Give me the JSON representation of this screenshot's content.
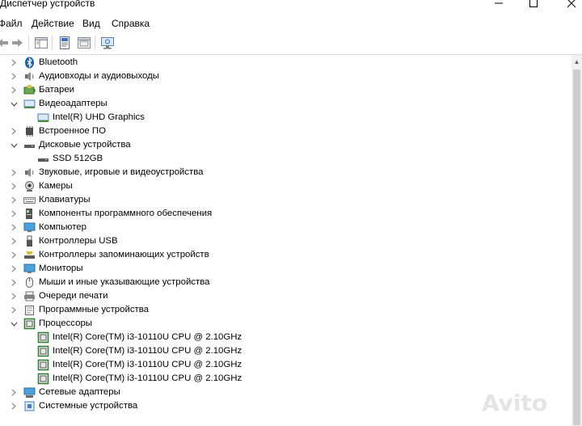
{
  "window": {
    "title": "Диспетчер устройств"
  },
  "menu": [
    "Файл",
    "Действие",
    "Вид",
    "Справка"
  ],
  "tree": [
    {
      "label": "Bluetooth",
      "icon": "bluetooth-icon",
      "level": 0,
      "state": "collapsed"
    },
    {
      "label": "Аудиовходы и аудиовыходы",
      "icon": "speaker-icon",
      "level": 0,
      "state": "collapsed"
    },
    {
      "label": "Батареи",
      "icon": "battery-icon",
      "level": 0,
      "state": "collapsed"
    },
    {
      "label": "Видеоадаптеры",
      "icon": "display-adapter-icon",
      "level": 0,
      "state": "expanded"
    },
    {
      "label": "Intel(R) UHD Graphics",
      "icon": "display-adapter-icon",
      "level": 1,
      "state": "leaf"
    },
    {
      "label": "Встроенное ПО",
      "icon": "firmware-icon",
      "level": 0,
      "state": "collapsed"
    },
    {
      "label": "Дисковые устройства",
      "icon": "disk-drive-icon",
      "level": 0,
      "state": "expanded"
    },
    {
      "label": "SSD 512GB",
      "icon": "disk-drive-icon",
      "level": 1,
      "state": "leaf"
    },
    {
      "label": "Звуковые, игровые и видеоустройства",
      "icon": "speaker-icon",
      "level": 0,
      "state": "collapsed"
    },
    {
      "label": "Камеры",
      "icon": "camera-icon",
      "level": 0,
      "state": "collapsed"
    },
    {
      "label": "Клавиатуры",
      "icon": "keyboard-icon",
      "level": 0,
      "state": "collapsed"
    },
    {
      "label": "Компоненты программного обеспечения",
      "icon": "software-component-icon",
      "level": 0,
      "state": "collapsed"
    },
    {
      "label": "Компьютер",
      "icon": "computer-icon",
      "level": 0,
      "state": "collapsed"
    },
    {
      "label": "Контроллеры USB",
      "icon": "usb-icon",
      "level": 0,
      "state": "collapsed"
    },
    {
      "label": "Контроллеры запоминающих устройств",
      "icon": "storage-controller-icon",
      "level": 0,
      "state": "collapsed"
    },
    {
      "label": "Мониторы",
      "icon": "monitor-icon",
      "level": 0,
      "state": "collapsed"
    },
    {
      "label": "Мыши и иные указывающие устройства",
      "icon": "mouse-icon",
      "level": 0,
      "state": "collapsed"
    },
    {
      "label": "Очереди печати",
      "icon": "printer-icon",
      "level": 0,
      "state": "collapsed"
    },
    {
      "label": "Программные устройства",
      "icon": "software-device-icon",
      "level": 0,
      "state": "collapsed"
    },
    {
      "label": "Процессоры",
      "icon": "processor-icon",
      "level": 0,
      "state": "expanded"
    },
    {
      "label": "Intel(R) Core(TM) i3-10110U CPU @ 2.10GHz",
      "icon": "processor-icon",
      "level": 1,
      "state": "leaf"
    },
    {
      "label": "Intel(R) Core(TM) i3-10110U CPU @ 2.10GHz",
      "icon": "processor-icon",
      "level": 1,
      "state": "leaf"
    },
    {
      "label": "Intel(R) Core(TM) i3-10110U CPU @ 2.10GHz",
      "icon": "processor-icon",
      "level": 1,
      "state": "leaf"
    },
    {
      "label": "Intel(R) Core(TM) i3-10110U CPU @ 2.10GHz",
      "icon": "processor-icon",
      "level": 1,
      "state": "leaf"
    },
    {
      "label": "Сетевые адаптеры",
      "icon": "network-adapter-icon",
      "level": 0,
      "state": "collapsed"
    },
    {
      "label": "Системные устройства",
      "icon": "system-device-icon",
      "level": 0,
      "state": "collapsed"
    }
  ],
  "watermark": "Avito"
}
